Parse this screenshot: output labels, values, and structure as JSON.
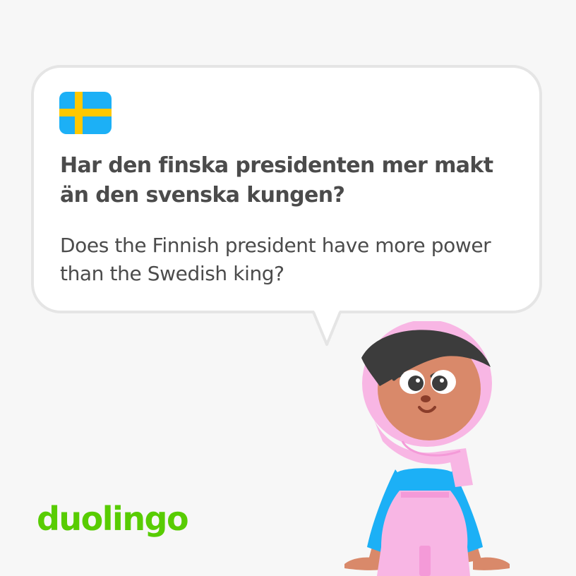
{
  "card": {
    "flag_icon": "sweden-flag-icon",
    "question": "Har den finska presidenten mer makt än den svenska kungen?",
    "translation": "Does the Finnish president have more power than the Swedish king?"
  },
  "brand": {
    "logo_text": "duolingo",
    "color": "#58cc02"
  },
  "character": {
    "icon": "hijab-woman-character-illustration"
  },
  "colors": {
    "background": "#f7f7f7",
    "bubble": "#ffffff",
    "bubble_border": "#e5e5e5",
    "text": "#4b4b4b",
    "flag_blue": "#1cb0f6",
    "flag_yellow": "#ffc800",
    "hijab_pink": "#f8b6e4",
    "shirt_blue": "#1cb0f6",
    "skin": "#d9896a",
    "hair": "#3c3c3c"
  }
}
